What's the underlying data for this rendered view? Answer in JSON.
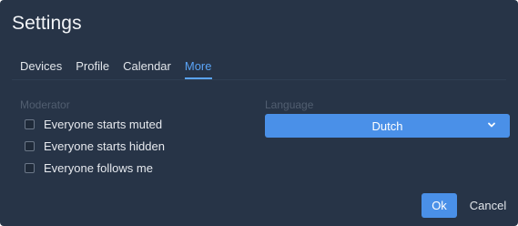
{
  "dialog": {
    "title": "Settings"
  },
  "tabs": [
    {
      "label": "Devices",
      "active": false
    },
    {
      "label": "Profile",
      "active": false
    },
    {
      "label": "Calendar",
      "active": false
    },
    {
      "label": "More",
      "active": true
    }
  ],
  "moderator": {
    "label": "Moderator",
    "options": [
      {
        "label": "Everyone starts muted",
        "checked": false
      },
      {
        "label": "Everyone starts hidden",
        "checked": false
      },
      {
        "label": "Everyone follows me",
        "checked": false
      }
    ]
  },
  "language": {
    "label": "Language",
    "selected": "Dutch",
    "icon": "chevron-down-icon"
  },
  "footer": {
    "ok_label": "Ok",
    "cancel_label": "Cancel"
  },
  "colors": {
    "background": "#273447",
    "accent": "#4a90e8",
    "active_tab": "#5aa3f5",
    "muted_label": "#515e70"
  }
}
